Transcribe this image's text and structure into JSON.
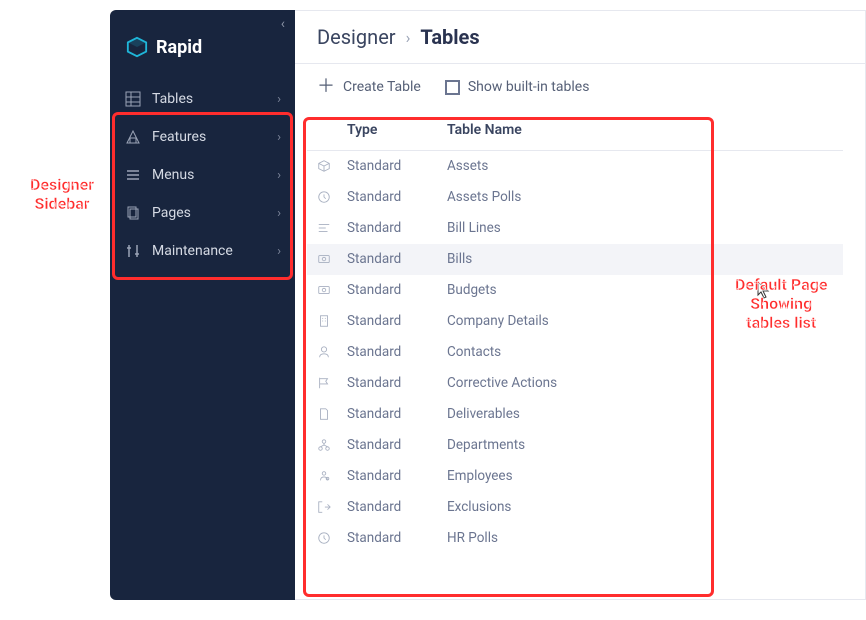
{
  "brand": {
    "name": "Rapid"
  },
  "sidebar": {
    "items": [
      {
        "icon": "tables-icon",
        "label": "Tables"
      },
      {
        "icon": "features-icon",
        "label": "Features"
      },
      {
        "icon": "menus-icon",
        "label": "Menus"
      },
      {
        "icon": "pages-icon",
        "label": "Pages"
      },
      {
        "icon": "maintenance-icon",
        "label": "Maintenance"
      }
    ]
  },
  "breadcrumb": {
    "parent": "Designer",
    "current": "Tables"
  },
  "toolbar": {
    "create_label": "Create Table",
    "show_builtin_label": "Show built-in tables",
    "show_builtin_checked": false
  },
  "table": {
    "headers": {
      "type": "Type",
      "name": "Table Name"
    },
    "rows": [
      {
        "icon": "cube-icon",
        "type": "Standard",
        "name": "Assets"
      },
      {
        "icon": "clock-icon",
        "type": "Standard",
        "name": "Assets Polls"
      },
      {
        "icon": "lines-icon",
        "type": "Standard",
        "name": "Bill Lines"
      },
      {
        "icon": "money-icon",
        "type": "Standard",
        "name": "Bills"
      },
      {
        "icon": "money-icon",
        "type": "Standard",
        "name": "Budgets"
      },
      {
        "icon": "building-icon",
        "type": "Standard",
        "name": "Company Details"
      },
      {
        "icon": "person-icon",
        "type": "Standard",
        "name": "Contacts"
      },
      {
        "icon": "flag-icon",
        "type": "Standard",
        "name": "Corrective Actions"
      },
      {
        "icon": "doc-icon",
        "type": "Standard",
        "name": "Deliverables"
      },
      {
        "icon": "org-icon",
        "type": "Standard",
        "name": "Departments"
      },
      {
        "icon": "badge-icon",
        "type": "Standard",
        "name": "Employees"
      },
      {
        "icon": "exit-icon",
        "type": "Standard",
        "name": "Exclusions"
      },
      {
        "icon": "clock-icon",
        "type": "Standard",
        "name": "HR Polls"
      }
    ],
    "hovered_index": 3
  },
  "callouts": {
    "left": "Designer\nSidebar",
    "right": "Default Page\nShowing\ntables list"
  }
}
